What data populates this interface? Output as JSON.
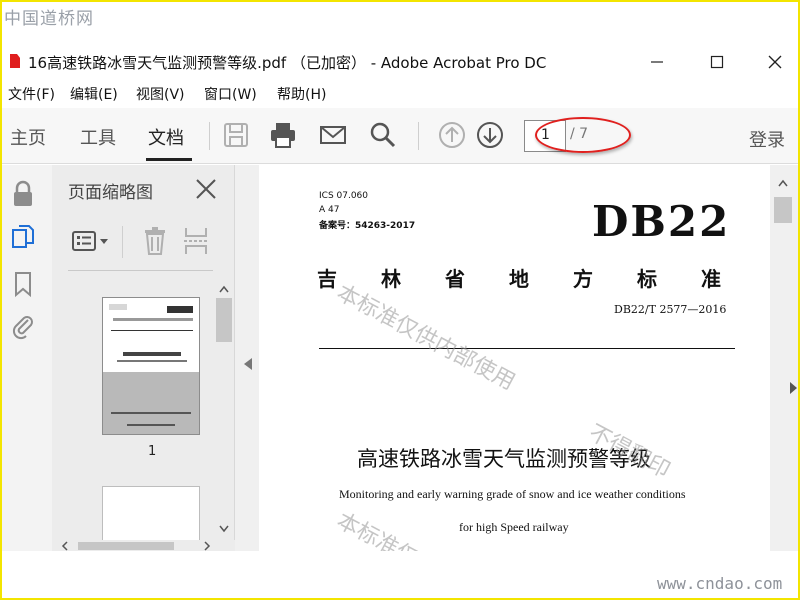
{
  "site_watermark": "中国道桥网",
  "site_url": "www.cndao.com",
  "window": {
    "title": "16高速铁路冰雪天气监测预警等级.pdf （已加密） - Adobe Acrobat Pro DC"
  },
  "menu": [
    "文件(F)",
    "编辑(E)",
    "视图(V)",
    "窗口(W)",
    "帮助(H)"
  ],
  "toolbar": {
    "tabs": [
      "主页",
      "工具",
      "文档"
    ],
    "active_tab": "文档",
    "current_page": "1",
    "total_pages": "/ 7",
    "login": "登录"
  },
  "thumbnails": {
    "title": "页面缩略图",
    "page_label": "1"
  },
  "document": {
    "ics": "ICS 07.060",
    "class": "A 47",
    "record": "备案号：54263-2017",
    "code_big": "DB22",
    "province_chars": [
      "吉",
      "林",
      "省",
      "地",
      "方",
      "标",
      "准"
    ],
    "code": "DB22/T 2577—2016",
    "title_cn": "高速铁路冰雪天气监测预警等级",
    "title_en_1": "Monitoring and early warning grade of snow and ice weather conditions",
    "title_en_2": "for high Speed railway",
    "watermark_1": "本标准仅供内部使用",
    "watermark_2": "不得翻印",
    "watermark_3": "本标准仅"
  },
  "colors": {
    "annotation_ellipse": "#e0201e",
    "page_border": "#f3e500"
  }
}
